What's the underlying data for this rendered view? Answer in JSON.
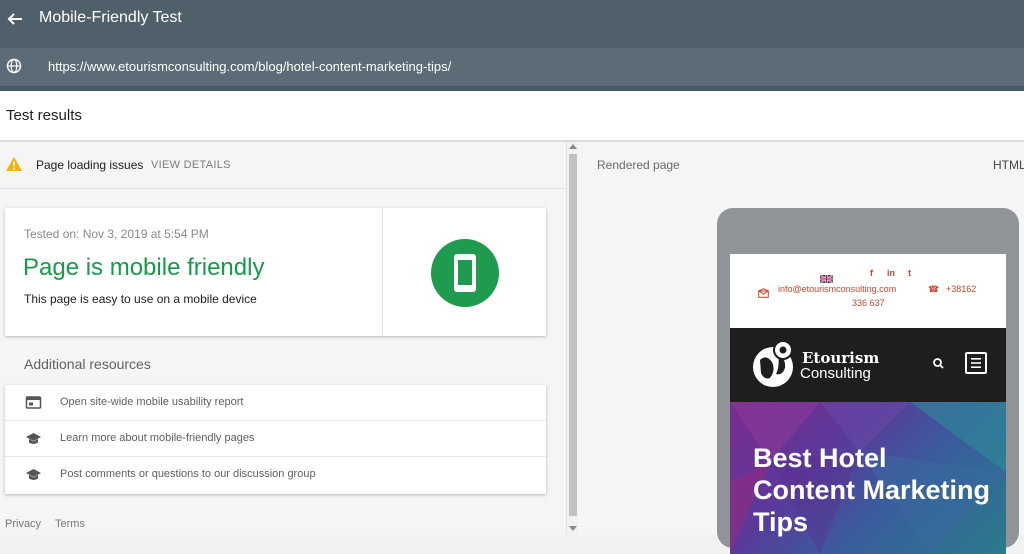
{
  "app": {
    "title": "Mobile-Friendly Test"
  },
  "url_bar": {
    "url": "https://www.etourismconsulting.com/blog/hotel-content-marketing-tips/"
  },
  "results": {
    "title": "Test results"
  },
  "issues": {
    "label": "Page loading issues",
    "action": "VIEW DETAILS"
  },
  "result_card": {
    "tested_on": "Tested on: Nov 3, 2019 at 5:54 PM",
    "verdict": "Page is mobile friendly",
    "subtitle": "This page is easy to use on a mobile device",
    "verdict_color": "#189a4b"
  },
  "additional_resources": {
    "title": "Additional resources",
    "items": [
      {
        "label": "Open site-wide mobile usability report",
        "icon": "report-icon"
      },
      {
        "label": "Learn more about mobile-friendly pages",
        "icon": "school-icon"
      },
      {
        "label": "Post comments or questions to our discussion group",
        "icon": "school-icon"
      }
    ]
  },
  "footer": {
    "privacy": "Privacy",
    "terms": "Terms"
  },
  "rendered": {
    "label": "Rendered page",
    "html_tab": "HTML",
    "site": {
      "email": "info@etourismconsulting.com",
      "phone_a": "+38162",
      "phone_b": "336 637",
      "social": [
        "f",
        "in",
        "t"
      ],
      "logo_name": "Etourism",
      "logo_sub": "Consulting",
      "hero_title": "Best Hotel Content Marketing Tips"
    }
  },
  "colors": {
    "topbar": "#4f606b",
    "urlbar": "#5b6c77",
    "success_green": "#1e9b4f",
    "warning": "#f4b400",
    "site_accent": "#c9452b"
  }
}
